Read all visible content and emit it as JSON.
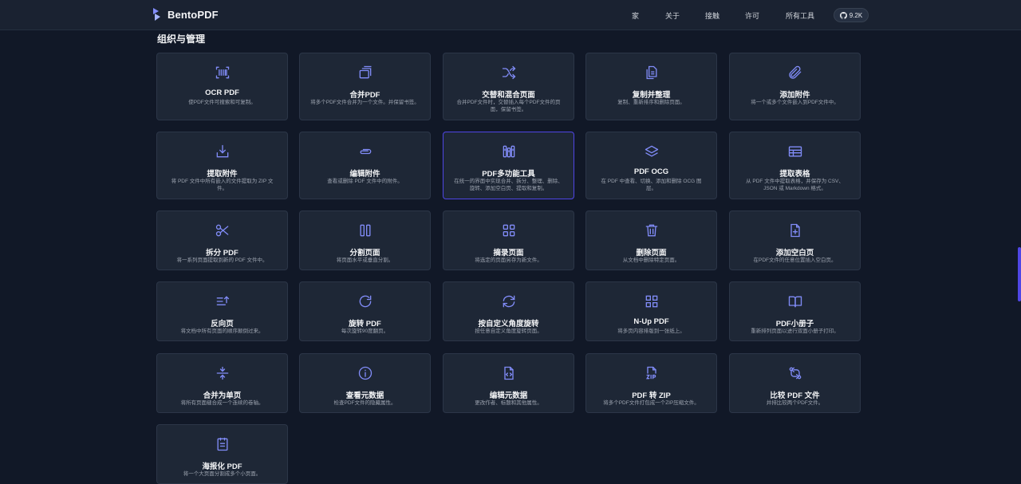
{
  "brand": {
    "name": "BentoPDF"
  },
  "nav": {
    "home": "家",
    "about": "关于",
    "contact": "接触",
    "license": "许可",
    "all_tools": "所有工具",
    "github_stars": "9.2K"
  },
  "section": {
    "title": "组织与管理"
  },
  "accent": "#818cf8",
  "cards": [
    {
      "icon": "ocr-scan-icon",
      "title": "OCR PDF",
      "desc": "使PDF文件可搜索和可复制。"
    },
    {
      "icon": "merge-stack-icon",
      "title": "合并PDF",
      "desc": "将多个PDF文件合并为一个文件。并保留书签。"
    },
    {
      "icon": "shuffle-icon",
      "title": "交替和混合页面",
      "desc": "合并PDF文件时，交替插入每个PDF文件的页面，保留书签。"
    },
    {
      "icon": "copy-document-icon",
      "title": "复制并整理",
      "desc": "复制、重新排序和删除页面。"
    },
    {
      "icon": "paperclip-icon",
      "title": "添加附件",
      "desc": "将一个或多个文件嵌入到PDF文件中。"
    },
    {
      "icon": "download-tray-icon",
      "title": "提取附件",
      "desc": "将 PDF 文件中所有嵌入的文件提取为 ZIP 文件。"
    },
    {
      "icon": "attachment-edit-icon",
      "title": "编辑附件",
      "desc": "查看或删除 PDF 文件中的附件。"
    },
    {
      "icon": "toolbox-icon",
      "title": "PDF多功能工具",
      "desc": "在统一的界面中实现合并、拆分、整理、删除、旋转、添加空白页、提取和复制。"
    },
    {
      "icon": "layers-icon",
      "title": "PDF OCG",
      "desc": "在 PDF 中查看、切换、添加和删除 OCG 图层。"
    },
    {
      "icon": "table-icon",
      "title": "提取表格",
      "desc": "从 PDF 文件中提取表格，并保存为 CSV、JSON 或 Markdown 格式。"
    },
    {
      "icon": "scissors-icon",
      "title": "拆分 PDF",
      "desc": "将一系列页面提取到新的 PDF 文件中。"
    },
    {
      "icon": "columns-icon",
      "title": "分割页面",
      "desc": "将页面水平或垂直分割。"
    },
    {
      "icon": "grid-icon",
      "title": "摘录页面",
      "desc": "将选定的页面另存为新文件。"
    },
    {
      "icon": "trash-icon",
      "title": "删除页面",
      "desc": "从文档中删除特定页面。"
    },
    {
      "icon": "file-plus-icon",
      "title": "添加空白页",
      "desc": "在PDF文件的任意位置插入空白页。"
    },
    {
      "icon": "sort-reverse-icon",
      "title": "反向页",
      "desc": "将文档中所有页面的顺序颠倒过来。"
    },
    {
      "icon": "rotate-icon",
      "title": "旋转 PDF",
      "desc": "每次旋转90度翻页。"
    },
    {
      "icon": "refresh-icon",
      "title": "按自定义角度旋转",
      "desc": "按任意自定义角度旋转页面。"
    },
    {
      "icon": "nup-grid-icon",
      "title": "N-Up PDF",
      "desc": "将多页内容排版到一张纸上。"
    },
    {
      "icon": "book-open-icon",
      "title": "PDF小册子",
      "desc": "重新排列页面以进行双面小册子打印。"
    },
    {
      "icon": "expand-vertical-icon",
      "title": "合并为单页",
      "desc": "将所有页面缝合成一个连续的卷轴。"
    },
    {
      "icon": "info-circle-icon",
      "title": "查看元数据",
      "desc": "检查PDF文件的隐藏属性。"
    },
    {
      "icon": "file-code-icon",
      "title": "编辑元数据",
      "desc": "更改作者、标题和其他属性。"
    },
    {
      "icon": "file-zip-icon",
      "title": "PDF 转 ZIP",
      "desc": "将多个PDF文件打包成一个ZIP压缩文件。"
    },
    {
      "icon": "git-compare-icon",
      "title": "比较 PDF 文件",
      "desc": "并排比较两个PDF文件。"
    },
    {
      "icon": "file-text-icon",
      "title": "海报化 PDF",
      "desc": "将一个大页面分割成多个小页面。"
    }
  ]
}
